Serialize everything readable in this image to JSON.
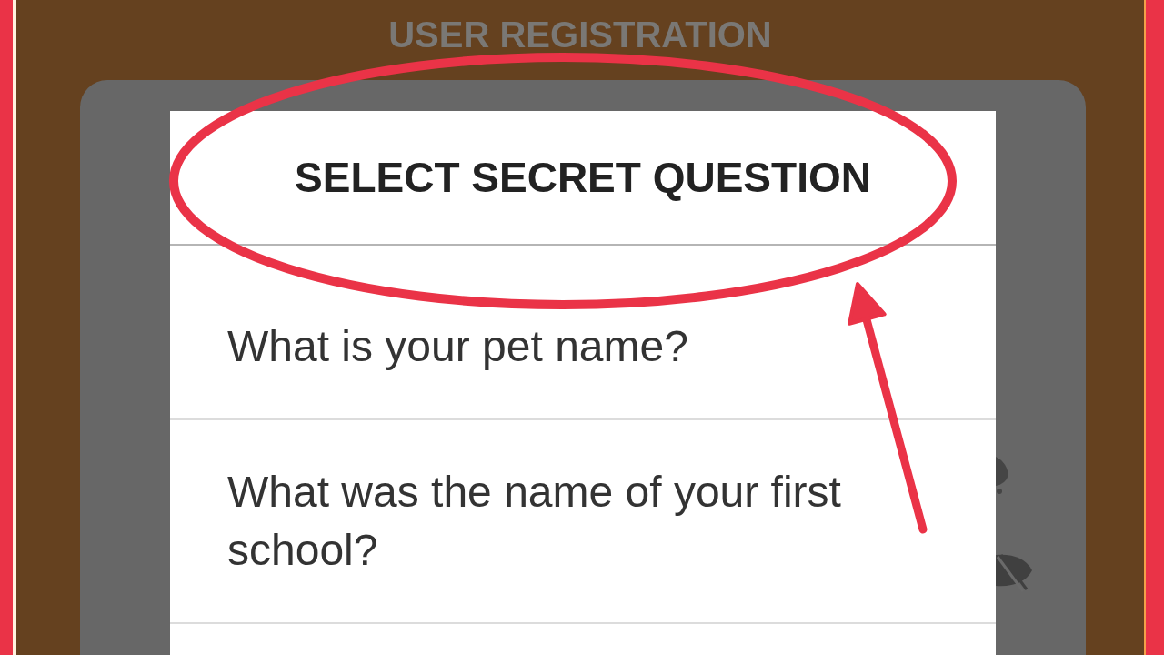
{
  "screen": {
    "title": "USER REGISTRATION"
  },
  "dialog": {
    "title": "SELECT SECRET QUESTION",
    "options": [
      {
        "label": "What is your pet name?",
        "selected": false
      },
      {
        "label": "What was the name of your first school?",
        "selected": false
      }
    ]
  }
}
